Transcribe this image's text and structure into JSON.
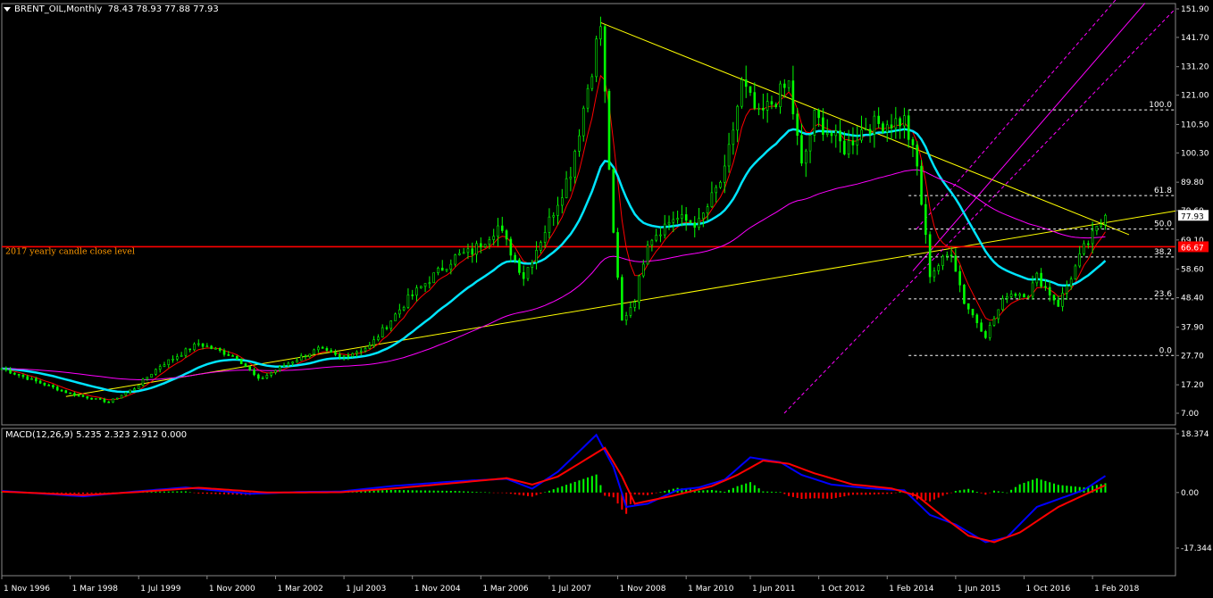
{
  "header": {
    "symbol": "BRENT_OIL,Monthly",
    "ohlc": "78.43 78.93 77.88 77.93"
  },
  "macd_header": "MACD(12,26,9) 5.235 2.323 2.912 0.000",
  "annotations": {
    "yearly_close": "2017 yearly candle close level",
    "price_badge": "77.93",
    "level_badge": "66.67"
  },
  "colors": {
    "background": "#000000",
    "candle": "#00ff00",
    "trendline": "#ffff00",
    "ema_fast": "#ff0000",
    "ema_mid": "#00e5ff",
    "ema_slow": "#ff00ff",
    "level_line": "#ff0000",
    "fib": "#ffffff",
    "channel": "#ff00ff",
    "macd_line": "#0000ff",
    "signal_line": "#ff0000",
    "hist_pos": "#00ff00",
    "hist_neg": "#ff0000"
  },
  "chart_data": [
    {
      "type": "candlestick",
      "title": "BRENT_OIL,Monthly",
      "y_axis_ticks": [
        "151.90",
        "141.70",
        "131.20",
        "121.00",
        "110.50",
        "100.30",
        "89.80",
        "79.60",
        "69.10",
        "58.60",
        "48.40",
        "37.90",
        "27.70",
        "17.20",
        "7.00"
      ],
      "x_axis_ticks": [
        "1 Nov 1996",
        "1 Mar 1998",
        "1 Jul 1999",
        "1 Nov 2000",
        "1 Mar 2002",
        "1 Jul 2003",
        "1 Nov 2004",
        "1 Mar 2006",
        "1 Jul 2007",
        "1 Nov 2008",
        "1 Mar 2010",
        "1 Jun 2011",
        "1 Oct 2012",
        "1 Feb 2014",
        "1 Jun 2015",
        "1 Oct 2016",
        "1 Feb 2018"
      ],
      "ylim": [
        7.0,
        151.9
      ],
      "price_path": [
        [
          "1996-11",
          23
        ],
        [
          "1997-06",
          19
        ],
        [
          "1998-03",
          14
        ],
        [
          "1998-12",
          11
        ],
        [
          "1999-06",
          16
        ],
        [
          "1999-12",
          24
        ],
        [
          "2000-09",
          32
        ],
        [
          "2001-06",
          27
        ],
        [
          "2001-11",
          19
        ],
        [
          "2002-06",
          25
        ],
        [
          "2003-01",
          30
        ],
        [
          "2003-06",
          27
        ],
        [
          "2004-01",
          31
        ],
        [
          "2004-10",
          48
        ],
        [
          "2005-03",
          55
        ],
        [
          "2005-09",
          63
        ],
        [
          "2006-01",
          65
        ],
        [
          "2006-07",
          74
        ],
        [
          "2007-01",
          56
        ],
        [
          "2007-07",
          76
        ],
        [
          "2007-12",
          94
        ],
        [
          "2008-06",
          139
        ],
        [
          "2008-07",
          146
        ],
        [
          "2008-10",
          70
        ],
        [
          "2008-12",
          40
        ],
        [
          "2009-03",
          48
        ],
        [
          "2009-06",
          69
        ],
        [
          "2009-12",
          77
        ],
        [
          "2010-06",
          75
        ],
        [
          "2010-12",
          93
        ],
        [
          "2011-04",
          125
        ],
        [
          "2011-08",
          113
        ],
        [
          "2012-03",
          125
        ],
        [
          "2012-06",
          95
        ],
        [
          "2012-09",
          113
        ],
        [
          "2013-04",
          102
        ],
        [
          "2013-09",
          110
        ],
        [
          "2014-06",
          112
        ],
        [
          "2014-09",
          95
        ],
        [
          "2014-12",
          57
        ],
        [
          "2015-05",
          65
        ],
        [
          "2015-08",
          47
        ],
        [
          "2016-01",
          35
        ],
        [
          "2016-06",
          50
        ],
        [
          "2016-11",
          50
        ],
        [
          "2017-01",
          56
        ],
        [
          "2017-06",
          46
        ],
        [
          "2017-12",
          66
        ],
        [
          "2018-04",
          75
        ],
        [
          "2018-05",
          77
        ]
      ],
      "fibonacci": [
        {
          "label": "100.0",
          "value": 115.7
        },
        {
          "label": "61.8",
          "value": 85.0
        },
        {
          "label": "50.0",
          "value": 73.0
        },
        {
          "label": "38.2",
          "value": 63.0
        },
        {
          "label": "23.6",
          "value": 48.0
        },
        {
          "label": "0.0",
          "value": 27.7
        }
      ],
      "horizontal_level": 66.67,
      "last_price": 77.93
    },
    {
      "type": "macd",
      "params": "MACD(12,26,9)",
      "y_axis_ticks": [
        "18.374",
        "0.00",
        "-17.344"
      ],
      "ylim": [
        -17.344,
        18.374
      ],
      "macd_path": [
        [
          "1996-11",
          0.5
        ],
        [
          "1998-06",
          -1.2
        ],
        [
          "1999-06",
          0.3
        ],
        [
          "2000-06",
          1.6
        ],
        [
          "2001-09",
          -0.4
        ],
        [
          "2002-09",
          0.2
        ],
        [
          "2003-06",
          0.3
        ],
        [
          "2004-06",
          2.0
        ],
        [
          "2005-09",
          3.5
        ],
        [
          "2006-09",
          4.3
        ],
        [
          "2007-03",
          1.2
        ],
        [
          "2007-09",
          6.5
        ],
        [
          "2008-06",
          18.0
        ],
        [
          "2008-10",
          8.0
        ],
        [
          "2009-01",
          -4.5
        ],
        [
          "2009-06",
          -3.5
        ],
        [
          "2010-01",
          0.8
        ],
        [
          "2010-06",
          1.6
        ],
        [
          "2010-12",
          4.0
        ],
        [
          "2011-06",
          11.0
        ],
        [
          "2012-01",
          9.5
        ],
        [
          "2012-06",
          5.5
        ],
        [
          "2013-01",
          2.5
        ],
        [
          "2013-09",
          1.4
        ],
        [
          "2014-06",
          0.7
        ],
        [
          "2014-12",
          -7.0
        ],
        [
          "2015-06",
          -10.0
        ],
        [
          "2016-01",
          -15.5
        ],
        [
          "2016-06",
          -14.0
        ],
        [
          "2017-01",
          -4.5
        ],
        [
          "2017-12",
          0.8
        ],
        [
          "2018-05",
          5.2
        ]
      ],
      "signal_path": [
        [
          "1996-11",
          0.3
        ],
        [
          "1998-06",
          -0.8
        ],
        [
          "1999-06",
          0.1
        ],
        [
          "2000-09",
          1.5
        ],
        [
          "2002-01",
          0.0
        ],
        [
          "2003-06",
          0.1
        ],
        [
          "2004-06",
          1.2
        ],
        [
          "2005-09",
          3.0
        ],
        [
          "2006-09",
          4.5
        ],
        [
          "2007-03",
          2.5
        ],
        [
          "2007-09",
          5.0
        ],
        [
          "2008-08",
          14.0
        ],
        [
          "2008-12",
          5.0
        ],
        [
          "2009-03",
          -3.5
        ],
        [
          "2009-12",
          -1.0
        ],
        [
          "2010-09",
          2.0
        ],
        [
          "2011-03",
          5.5
        ],
        [
          "2011-09",
          10.0
        ],
        [
          "2012-03",
          9.0
        ],
        [
          "2012-09",
          6.0
        ],
        [
          "2013-06",
          2.5
        ],
        [
          "2014-03",
          1.3
        ],
        [
          "2014-09",
          -1.0
        ],
        [
          "2015-03",
          -7.5
        ],
        [
          "2015-09",
          -13.5
        ],
        [
          "2016-03",
          -15.5
        ],
        [
          "2016-09",
          -12.5
        ],
        [
          "2017-06",
          -4.5
        ],
        [
          "2018-05",
          2.3
        ]
      ]
    }
  ]
}
